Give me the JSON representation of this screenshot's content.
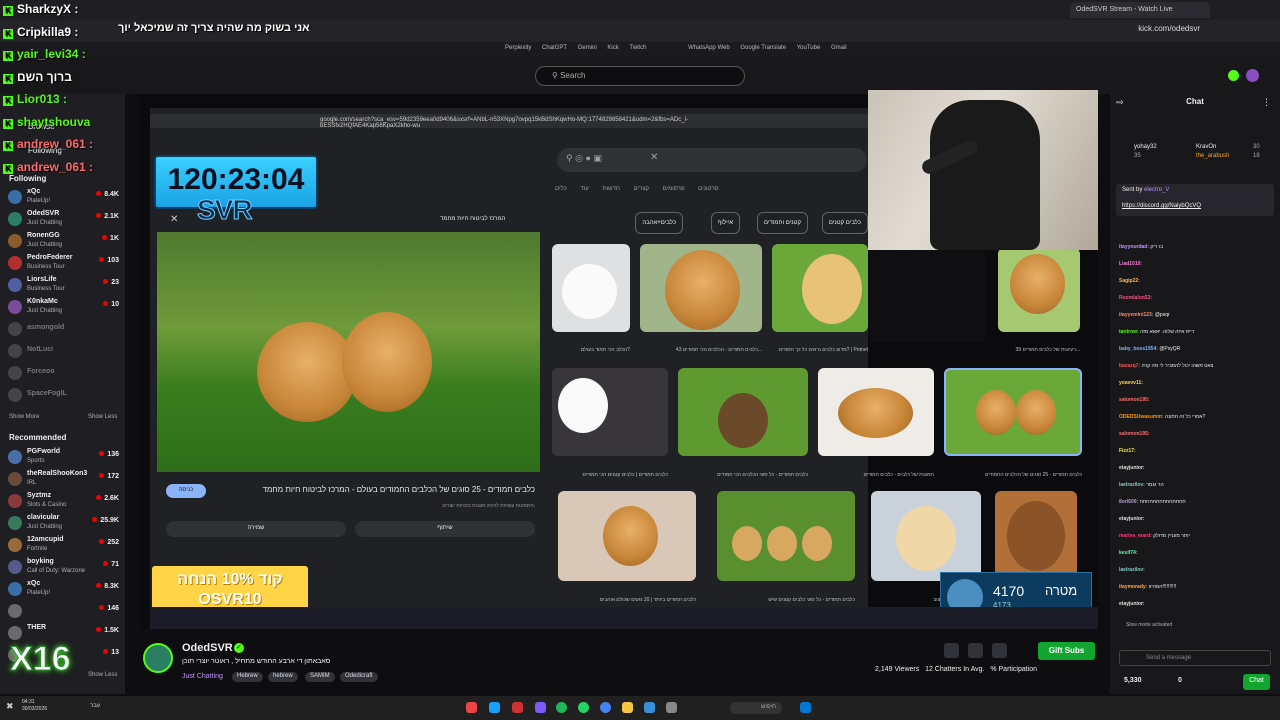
{
  "browser": {
    "active_tab": "OdedSVR Stream - Watch Live",
    "url": "kick.com/odedsvr",
    "bookmarks": [
      "Perplexity",
      "ChatGPT",
      "Gemini",
      "Kick",
      "Twitch",
      "WhatsApp Web",
      "Google Translate",
      "YouTube",
      "Gmail"
    ]
  },
  "nav": {
    "search_placeholder": "Search"
  },
  "overlay_chat": [
    {
      "name": "SharkzyX :",
      "color": "#ffffff"
    },
    {
      "name": "Cripkilla9 :",
      "color": "#ffffff"
    },
    {
      "name": "yair_levi34 :",
      "color": "#53fc18"
    },
    {
      "name": "ברוך השם",
      "color": "#ffffff"
    },
    {
      "name": "Lior013 :",
      "color": "#53fc18"
    },
    {
      "name": "shaytshouva",
      "color": "#53fc18"
    },
    {
      "name": "andrew_061 :",
      "color": "#ff6b6b"
    },
    {
      "name": "andrew_061 :",
      "color": "#ff6b6b"
    }
  ],
  "overlay_message": "אני בשוק מה שהיה צריך זה שמיכאל יוך",
  "sidebar": {
    "browse": "Browse",
    "following_tab": "Following",
    "following_label": "Following",
    "following": [
      {
        "name": "xQc",
        "game": "PlateUp!",
        "viewers": "8.4K",
        "color": "#3a6ea5"
      },
      {
        "name": "OdedSVR",
        "game": "Just Chatting",
        "viewers": "2.1K",
        "color": "#2a7f62"
      },
      {
        "name": "RonenGG",
        "game": "Just Chatting",
        "viewers": "1K",
        "color": "#8a5a2b"
      },
      {
        "name": "PedroFederer",
        "game": "Business Tour",
        "viewers": "103",
        "color": "#b03030"
      },
      {
        "name": "LiorsLife",
        "game": "Business Tour",
        "viewers": "23",
        "color": "#5060a0"
      },
      {
        "name": "K0nkaMc",
        "game": "Just Chatting",
        "viewers": "10",
        "color": "#7a4d9a"
      }
    ],
    "offline": [
      "asmongold",
      "NotLuci",
      "Forceoo",
      "SpaceFogIL"
    ],
    "show_more": "Show More",
    "show_less": "Show Less",
    "recommended_label": "Recommended",
    "recommended": [
      {
        "name": "PGFworld",
        "game": "Sports",
        "viewers": "136",
        "color": "#4a6fa5"
      },
      {
        "name": "theRealShooKon3",
        "game": "IRL",
        "viewers": "172",
        "color": "#6a4a3a"
      },
      {
        "name": "Syztmz",
        "game": "Slots & Casino",
        "viewers": "2.6K",
        "color": "#8a3a3a"
      },
      {
        "name": "clavicular",
        "game": "Just Chatting",
        "viewers": "25.9K",
        "color": "#3a7a5a"
      },
      {
        "name": "12amcupid",
        "game": "Fortnite",
        "viewers": "252",
        "color": "#9a6a3a"
      },
      {
        "name": "boyking",
        "game": "Call of Duty: Warzone",
        "viewers": "71",
        "color": "#555a8a"
      },
      {
        "name": "xQc",
        "game": "PlateUp!",
        "viewers": "8.3K",
        "color": "#3a6ea5"
      },
      {
        "name": "",
        "game": "",
        "viewers": "146",
        "color": "#6a6a6a"
      },
      {
        "name": "THER",
        "game": "",
        "viewers": "1.5K",
        "color": "#6a6a6a"
      },
      {
        "name": "",
        "game": "",
        "viewers": "13",
        "color": "#6a6a6a"
      }
    ],
    "show_less_bottom": "Show Less"
  },
  "overlay": {
    "timer": "120:23:04",
    "logo": "SVR",
    "promo_line1": "קוד 10% הנחה",
    "promo_line2": "OSVR10",
    "counter_value": "4170",
    "counter_sub": "4173",
    "counter_label": "מטרה",
    "x16": "X16"
  },
  "google": {
    "url": "google.com/search?sca_esv=59d2359eea0d9406&sxsrf=ANbL-n53XNpg7ovpq15kBdShKqwHo-MQ:1774829858421&udm=2&fbs=ADc_l-bESSfx2HQfAE4Kap56KpaX2kho-wu",
    "filters": [
      "סרטונים",
      "פרסומים קצרים",
      "חדשות",
      "עוד",
      "כלים"
    ],
    "chips": [
      "כלבים קטנים",
      "קטנים וחמודים",
      "איילוף",
      "כלבים+אהבה",
      "המרכז לביטוח חיות מחמד"
    ],
    "preview_title": "כלבים חמודים - 25 סוגים של הכלבים החמודים בעולם - המרכז לביטוח חיות מחמד",
    "preview_desc": "התמונות עשויות להיות מוגנות בזכויות יוצרים.",
    "visit_btn": "כניסה",
    "share_btn": "שיתוף",
    "save_btn": "שמירה",
    "captions": [
      "הכלב הכי חמוד בעולם?",
      "כלבים חמודים - הכלבים הכי חמודים 43...",
      "מדוע כלבים נראים כל כך חמודים? | Petnet",
      "39 רעיונות של כלבים חמודים...",
      "כלבים חמודים | כלבים קטנים הכי חמודים",
      "כלבים חמודים - כל סוגי הכלבים הכי חמודים",
      "תמונות של כלבים - כלבים חמודים",
      "כלבים חמודים - 25 סוגים של הכלבים החמודים",
      "כלבים חמודים ביותר | 20 גזעים שכולם אוהבים",
      "כלבים חמודים - כל סוגי כלבים קטנים שיש",
      "כלבים חמודים בעיצוב?"
    ]
  },
  "stream_info": {
    "streamer": "OdedSVR",
    "title": "סאבאתון די ארבע החודש מתחיל , ראוטר יוצרי תוכן",
    "category": "Just Chatting",
    "tags": [
      "Hebrew",
      "hebrew",
      "SAMIM",
      "Odedicraft"
    ],
    "viewers": "2,149 Viewers",
    "chatters": "12 Chatters In Avg.",
    "participation": "% Participation",
    "gift_button": "Gift Subs"
  },
  "chat": {
    "title": "Chat",
    "top_gifters": [
      {
        "name": "yohay32",
        "count": "35"
      },
      {
        "name": "KravOn",
        "count": "30"
      },
      {
        "name": "the_arabush",
        "count": "18"
      }
    ],
    "pinned_sender": "electro_V",
    "pinned_link": "https://discord.gg/NaiybQcVQ",
    "messages": [
      {
        "user": "itayyourdad:",
        "text": "בו ריק",
        "color": "#bf94ff"
      },
      {
        "user": "Liad1010:",
        "text": "",
        "color": "#ff7ad9"
      },
      {
        "user": "Sagip22:",
        "text": "",
        "color": "#ffb74d"
      },
      {
        "user": "Roomlalon53:",
        "text": "",
        "color": "#ff4f8b"
      },
      {
        "user": "itayyemini123:",
        "text": "@psqr",
        "color": "#ff8a65"
      },
      {
        "user": "tantrow:",
        "text": "דייס איזה שלוה. יאאא מזה",
        "color": "#53fc18"
      },
      {
        "user": "baby_boss1954:",
        "text": "@PsyQR",
        "color": "#82b1ff"
      },
      {
        "user": "bazazq7:",
        "text": "צאט משהו יכול להסביר לי מה קרה",
        "color": "#ff5252"
      },
      {
        "user": "yoavvv11:",
        "text": "",
        "color": "#ffd54f"
      },
      {
        "user": "salomon195:",
        "text": "",
        "color": "#ff6e6e"
      },
      {
        "user": "ODEDSUwasumm:",
        "text": "אחרי כל זה חתונה?",
        "color": "#ff9800"
      },
      {
        "user": "salomon195:",
        "text": "",
        "color": "#ff6e6e"
      },
      {
        "user": "Fizz17:",
        "text": "",
        "color": "#ffeb3b"
      },
      {
        "user": "etayjunior:",
        "text": "",
        "color": "#e0e0e0"
      },
      {
        "user": "laelrazilov:",
        "text": "הר גנמר",
        "color": "#80cbc4"
      },
      {
        "user": "8orl600:",
        "text": "חחחחחחחחחחחחחח",
        "color": "#b39ddb"
      },
      {
        "user": "etayjunior:",
        "text": "",
        "color": "#e0e0e0"
      },
      {
        "user": "mariva_mard:",
        "text": "יותר מעניין מדולק",
        "color": "#ff4081"
      },
      {
        "user": "kesif74:",
        "text": "",
        "color": "#69f0ae"
      },
      {
        "user": "laelrazilov:",
        "text": "",
        "color": "#80cbc4"
      },
      {
        "user": "itaymorady:",
        "text": "המהיוו!!!!!!!!!!",
        "color": "#ffab40"
      },
      {
        "user": "etayjunior:",
        "text": "",
        "color": "#e0e0e0"
      }
    ],
    "slow_mode": "Slow mode activated",
    "input_placeholder": "Send a message",
    "points": "5,330",
    "zero": "0",
    "chat_button": "Chat"
  },
  "windows": {
    "time": "04:31",
    "date": "30/03/2026",
    "lang": "עבר",
    "search": "חיפוש"
  }
}
